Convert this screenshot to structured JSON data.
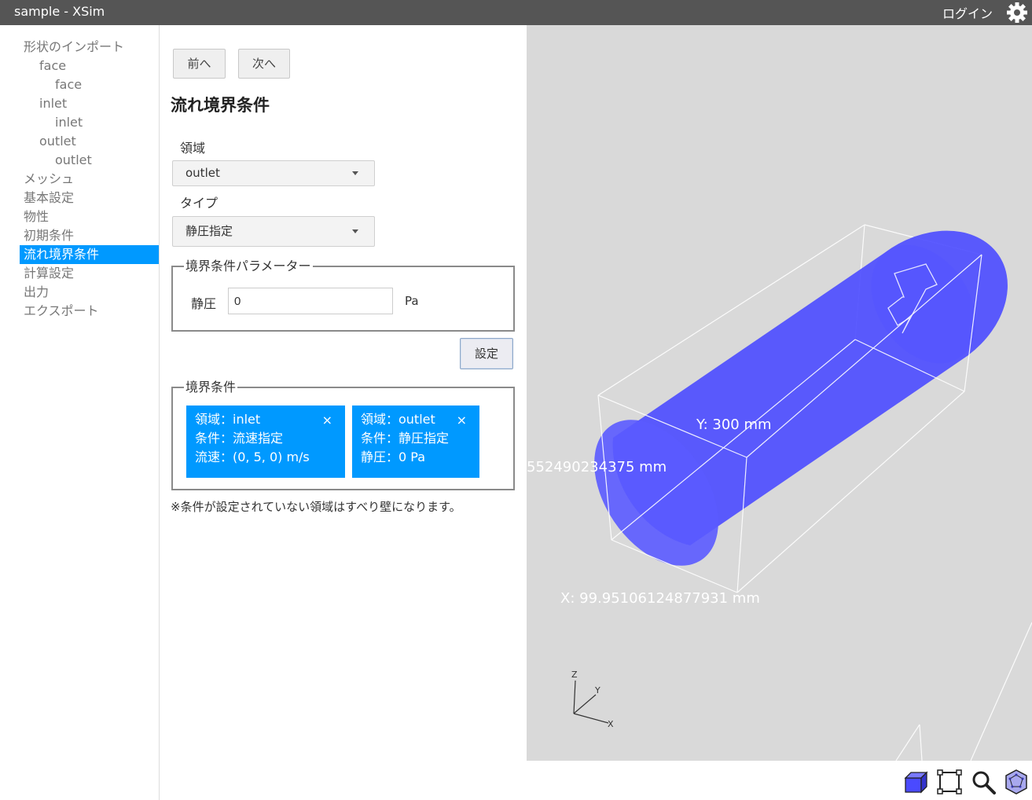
{
  "titlebar": {
    "app_title": "sample - XSim",
    "login_label": "ログイン"
  },
  "sidebar": {
    "items": [
      {
        "label": "形状のインポート"
      },
      {
        "label": "face"
      },
      {
        "label": "face"
      },
      {
        "label": "inlet"
      },
      {
        "label": "inlet"
      },
      {
        "label": "outlet"
      },
      {
        "label": "outlet"
      },
      {
        "label": "メッシュ"
      },
      {
        "label": "基本設定"
      },
      {
        "label": "物性"
      },
      {
        "label": "初期条件"
      },
      {
        "label": "流れ境界条件"
      },
      {
        "label": "計算設定"
      },
      {
        "label": "出力"
      },
      {
        "label": "エクスポート"
      }
    ]
  },
  "panel": {
    "prev_label": "前へ",
    "next_label": "次へ",
    "heading": "流れ境界条件",
    "region_label": "領域",
    "region_value": "outlet",
    "type_label": "タイプ",
    "type_value": "静圧指定",
    "params_legend": "境界条件パラメーター",
    "param_label": "静圧",
    "param_value": "0",
    "param_unit": "Pa",
    "set_label": "設定",
    "conditions_legend": "境界条件",
    "cards": [
      {
        "line1": "領域：inlet",
        "line2": "条件：流速指定",
        "line3": "流速：(0, 5, 0) m/s",
        "close": "×"
      },
      {
        "line1": "領域：outlet",
        "line2": "条件：静圧指定",
        "line3": "静圧：0 Pa",
        "close": "×"
      }
    ],
    "note": "※条件が設定されていない領域はすべり壁になります。"
  },
  "viewport": {
    "y_dimension": "Y: 300 mm",
    "z_dimension": "552490234375 mm",
    "x_dimension": "X: 99.95106124877931 mm",
    "axis_z": "Z",
    "axis_y": "Y",
    "axis_x": "X"
  },
  "colors": {
    "accent": "#0099ff",
    "titlebar": "#555555",
    "model": "#4a4aff",
    "viewport_bg": "#d9d9d9"
  },
  "icons": [
    "gear-icon",
    "cube-view-icon",
    "fit-view-icon",
    "zoom-icon",
    "polyhedron-icon"
  ]
}
